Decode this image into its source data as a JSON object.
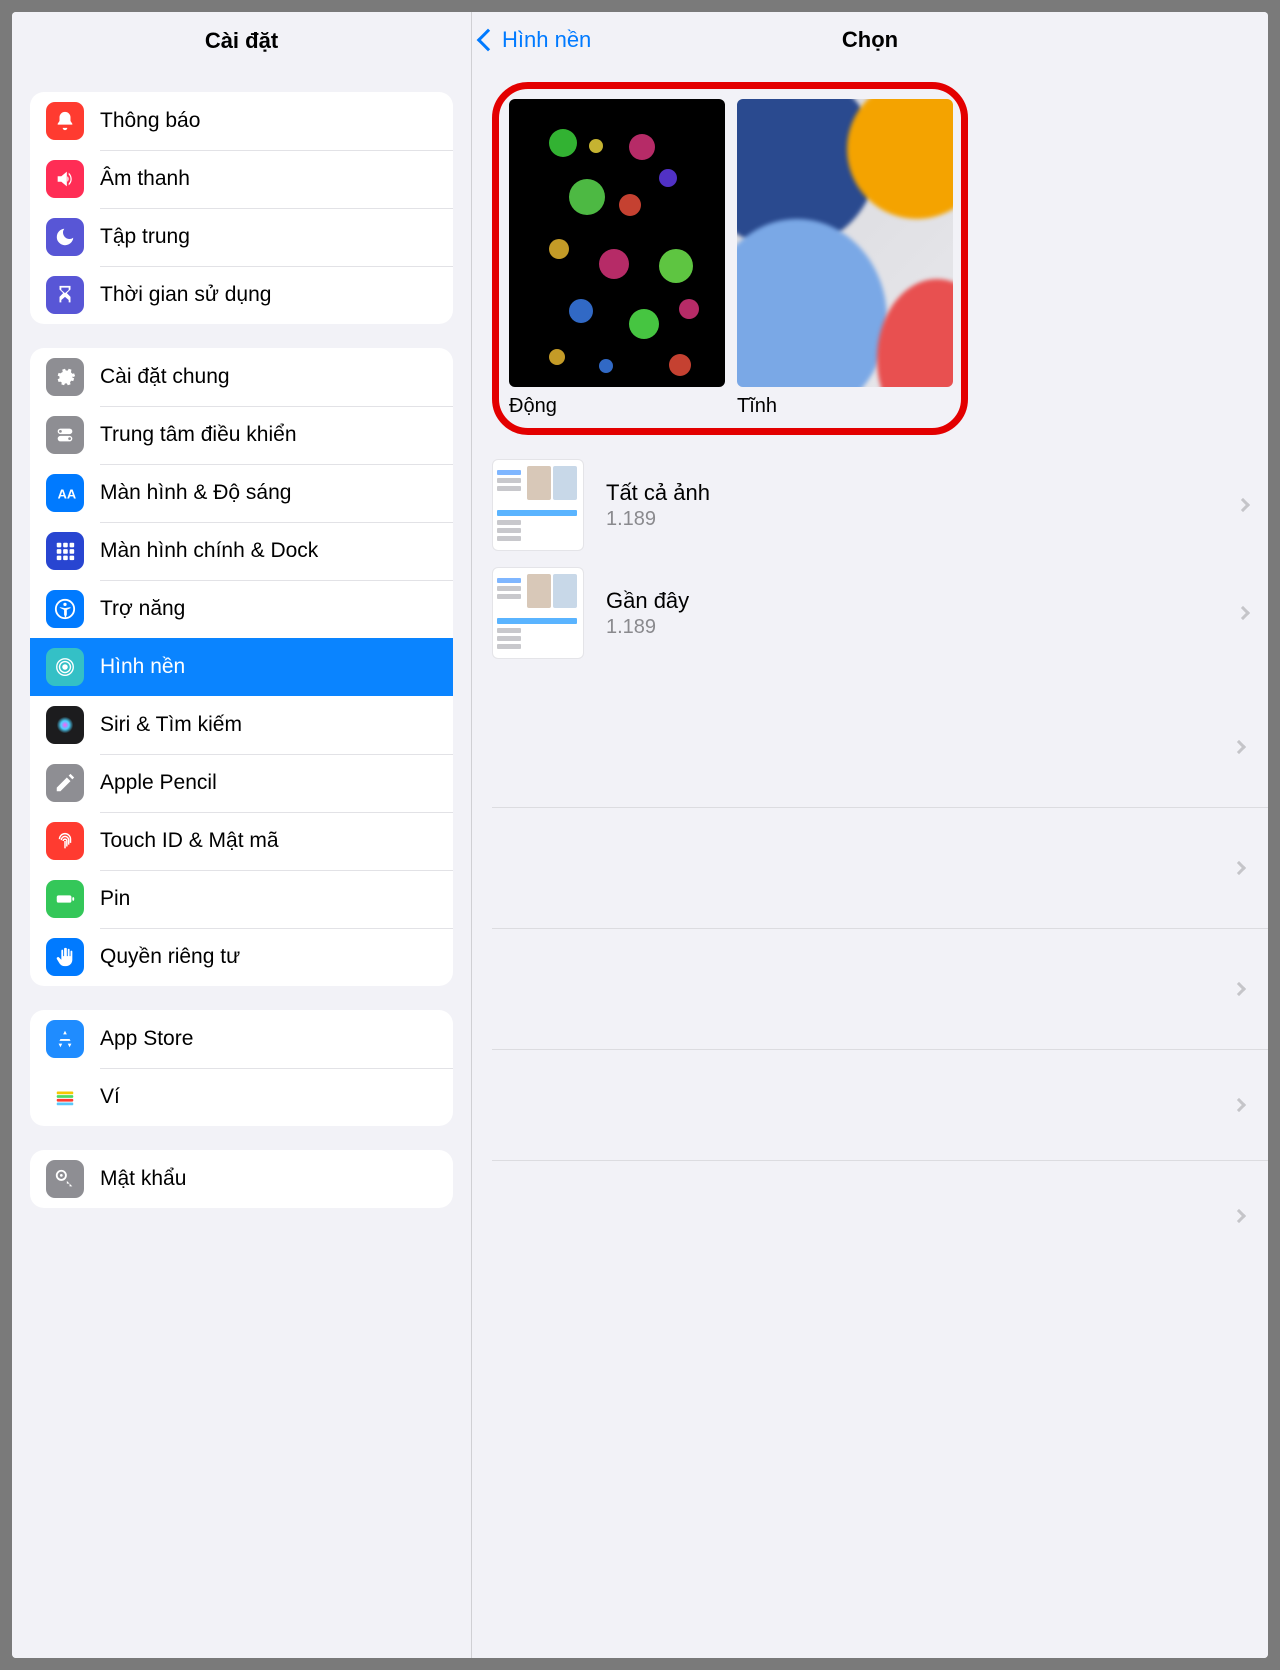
{
  "sidebar": {
    "title": "Cài đặt",
    "groups": [
      {
        "items": [
          {
            "label": "Thông báo",
            "icon": "bell",
            "color": "#ff3b30"
          },
          {
            "label": "Âm thanh",
            "icon": "speaker",
            "color": "#ff2d55"
          },
          {
            "label": "Tập trung",
            "icon": "moon",
            "color": "#5856d6"
          },
          {
            "label": "Thời gian sử dụng",
            "icon": "hourglass",
            "color": "#5856d6"
          }
        ]
      },
      {
        "items": [
          {
            "label": "Cài đặt chung",
            "icon": "gear",
            "color": "#8e8e93"
          },
          {
            "label": "Trung tâm điều khiển",
            "icon": "switches",
            "color": "#8e8e93"
          },
          {
            "label": "Màn hình & Độ sáng",
            "icon": "display",
            "color": "#007aff"
          },
          {
            "label": "Màn hình chính & Dock",
            "icon": "grid",
            "color": "#2845d1"
          },
          {
            "label": "Trợ năng",
            "icon": "accessibility",
            "color": "#007aff"
          },
          {
            "label": "Hình nền",
            "icon": "wallpaper",
            "color": "#34c0c6",
            "active": true
          },
          {
            "label": "Siri & Tìm kiếm",
            "icon": "siri",
            "color": "#1c1c1e"
          },
          {
            "label": "Apple Pencil",
            "icon": "pencil",
            "color": "#8e8e93"
          },
          {
            "label": "Touch ID & Mật mã",
            "icon": "fingerprint",
            "color": "#ff3b30"
          },
          {
            "label": "Pin",
            "icon": "battery",
            "color": "#34c759"
          },
          {
            "label": "Quyền riêng tư",
            "icon": "hand",
            "color": "#007aff"
          }
        ]
      },
      {
        "items": [
          {
            "label": "App Store",
            "icon": "appstore",
            "color": "#1f8cff"
          },
          {
            "label": "Ví",
            "icon": "wallet",
            "color": "#000000"
          }
        ]
      },
      {
        "items": [
          {
            "label": "Mật khẩu",
            "icon": "key",
            "color": "#8e8e93"
          }
        ]
      }
    ]
  },
  "detail": {
    "back_label": "Hình nền",
    "title": "Chọn",
    "wallpaper_types": [
      {
        "key": "dynamic",
        "label": "Động"
      },
      {
        "key": "still",
        "label": "Tĩnh"
      }
    ],
    "albums": [
      {
        "title": "Tất cả ảnh",
        "count": "1.189"
      },
      {
        "title": "Gần đây",
        "count": "1.189"
      }
    ],
    "ghost_rows": 5
  }
}
